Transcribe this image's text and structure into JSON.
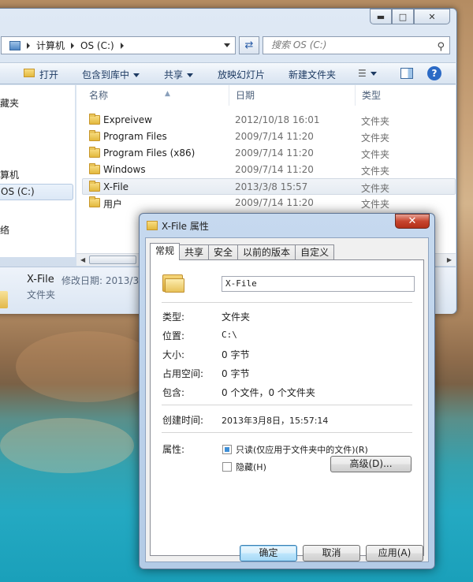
{
  "explorer": {
    "address": {
      "crumbs": [
        "计算机",
        "OS (C:)"
      ]
    },
    "search_placeholder": "搜索 OS (C:)",
    "toolbar": {
      "open": "打开",
      "include_library": "包含到库中",
      "share": "共享",
      "slideshow": "放映幻灯片",
      "new_folder": "新建文件夹"
    },
    "nav": {
      "favorites": "藏夹",
      "computer": "算机",
      "drive": "OS (C:)",
      "network": "络"
    },
    "columns": {
      "name": "名称",
      "date": "日期",
      "type": "类型"
    },
    "files": [
      {
        "name": "Expreivew",
        "date": "2012/10/18 16:01",
        "type": "文件夹"
      },
      {
        "name": "Program Files",
        "date": "2009/7/14 11:20",
        "type": "文件夹"
      },
      {
        "name": "Program Files (x86)",
        "date": "2009/7/14 11:20",
        "type": "文件夹"
      },
      {
        "name": "Windows",
        "date": "2009/7/14 11:20",
        "type": "文件夹"
      },
      {
        "name": "X-File",
        "date": "2013/3/8 15:57",
        "type": "文件夹"
      },
      {
        "name": "用户",
        "date": "2009/7/14 11:20",
        "type": "文件夹"
      }
    ],
    "selected_index": 4,
    "details": {
      "name": "X-File",
      "meta": "修改日期: 2013/3/",
      "type": "文件夹"
    }
  },
  "dialog": {
    "title": "X-File 属性",
    "tabs": [
      "常规",
      "共享",
      "安全",
      "以前的版本",
      "自定义"
    ],
    "active_tab": 0,
    "folder_name": "X-File",
    "fields": [
      {
        "label": "类型:",
        "value": "文件夹"
      },
      {
        "label": "位置:",
        "value": "C:\\"
      },
      {
        "label": "大小:",
        "value": "0 字节"
      },
      {
        "label": "占用空间:",
        "value": "0 字节"
      },
      {
        "label": "包含:",
        "value": "0 个文件，0 个文件夹"
      }
    ],
    "created_label": "创建时间:",
    "created_value": "2013年3月8日，15:57:14",
    "attributes_label": "属性:",
    "readonly_label": "只读(仅应用于文件夹中的文件)(R)",
    "hidden_label": "隐藏(H)",
    "advanced_button": "高级(D)...",
    "ok_button": "确定",
    "cancel_button": "取消",
    "apply_button": "应用(A)"
  }
}
